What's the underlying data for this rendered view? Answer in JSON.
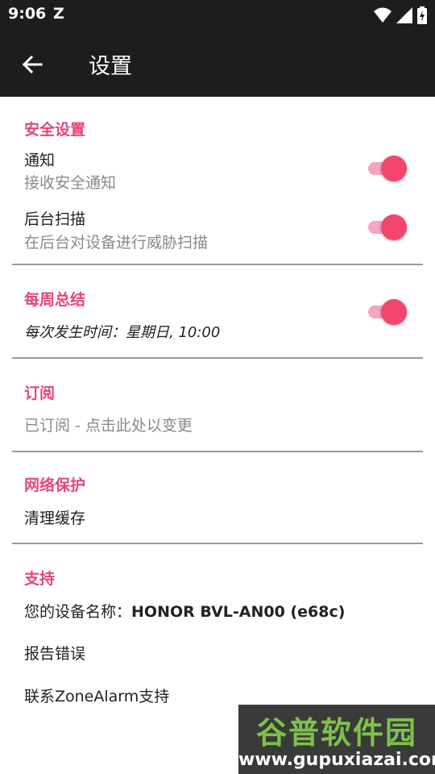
{
  "status_bar": {
    "time": "9:06",
    "notification_glyph": "Z",
    "icons": [
      "wifi-icon",
      "signal-icon",
      "battery-charging-icon"
    ]
  },
  "app_bar": {
    "title": "设置",
    "back_icon": "arrow-left-icon"
  },
  "security": {
    "title": "安全设置",
    "notify": {
      "title": "通知",
      "subtitle": "接收安全通知",
      "enabled": true
    },
    "background_scan": {
      "title": "后台扫描",
      "subtitle": "在后台对设备进行威胁扫描",
      "enabled": true
    }
  },
  "weekly": {
    "title": "每周总结",
    "schedule": "每次发生时间：星期日, 10:00",
    "enabled": true
  },
  "subscription": {
    "title": "订阅",
    "status": "已订阅 - 点击此处以变更"
  },
  "network": {
    "title": "网络保护",
    "clear_cache": "清理缓存"
  },
  "support": {
    "title": "支持",
    "device_label": "您的设备名称：",
    "device_name": "HONOR BVL-AN00 (e68c)",
    "report_bug": "报告错误",
    "contact": "联系ZoneAlarm支持"
  },
  "watermark": {
    "top": "谷普软件园",
    "bottom": "www.gupuxiazai.com"
  },
  "colors": {
    "accent": "#e5467a",
    "switch_thumb": "#f2466f",
    "switch_track": "#f3a6bf",
    "bar_bg": "#1d1d1d"
  }
}
